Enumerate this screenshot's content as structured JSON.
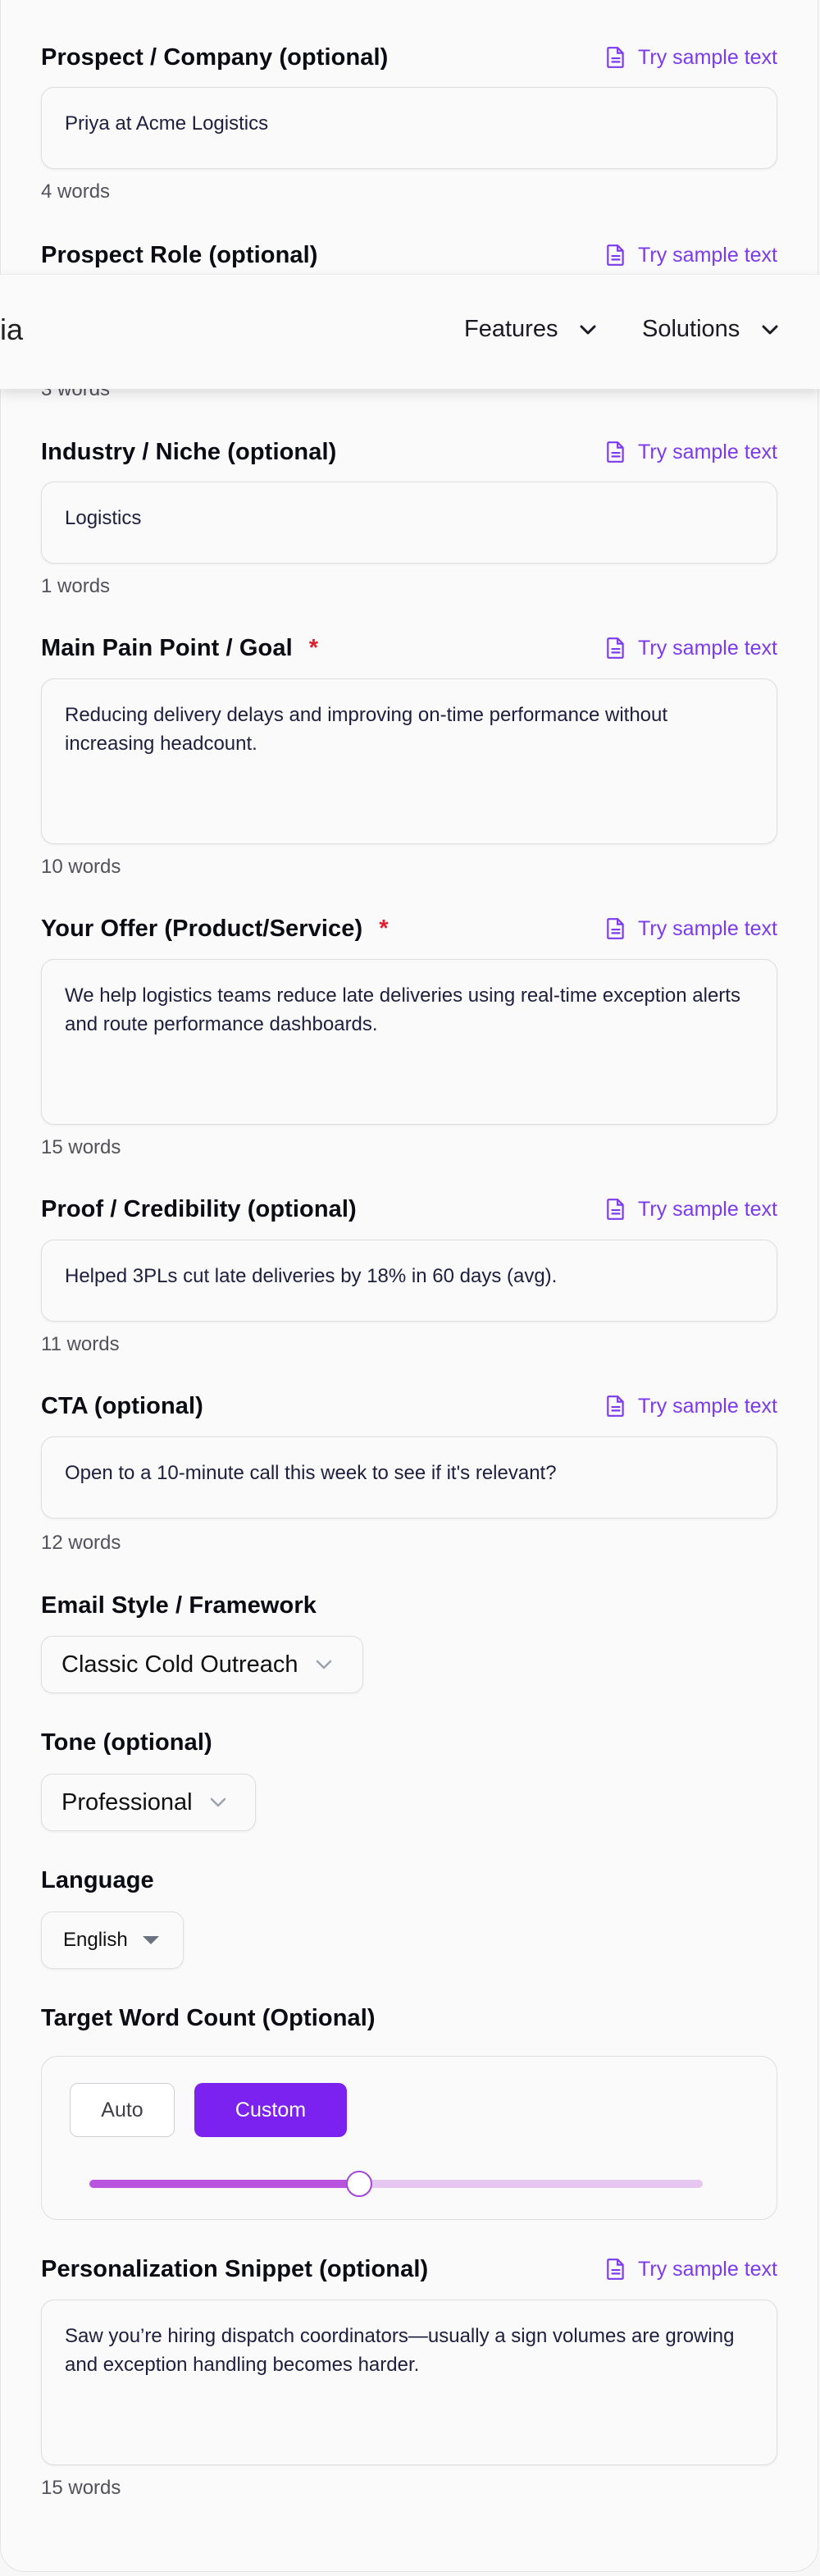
{
  "sample_link_label": "Try sample text",
  "fields": {
    "prospect": {
      "label": "Prospect / Company (optional)",
      "value": "Priya at Acme Logistics",
      "count": "4 words"
    },
    "role": {
      "label": "Prospect Role (optional)",
      "count": "3 words"
    },
    "industry": {
      "label": "Industry / Niche (optional)",
      "value": "Logistics",
      "count": "1 words"
    },
    "pain": {
      "label": "Main Pain Point / Goal",
      "required": "*",
      "value": "Reducing delivery delays and improving on-time performance without increasing headcount.",
      "count": "10 words"
    },
    "offer": {
      "label": "Your Offer (Product/Service)",
      "required": "*",
      "value": "We help logistics teams reduce late deliveries using real-time exception alerts and route performance dashboards.",
      "count": "15 words"
    },
    "proof": {
      "label": "Proof / Credibility (optional)",
      "value": "Helped 3PLs cut late deliveries by 18% in 60 days (avg).",
      "count": "11 words"
    },
    "cta": {
      "label": "CTA (optional)",
      "value": "Open to a 10-minute call this week to see if it's relevant?",
      "count": "12 words"
    },
    "snippet": {
      "label": "Personalization Snippet (optional)",
      "value": "Saw you’re hiring dispatch coordinators—usually a sign volumes are growing and exception handling becomes harder.",
      "count": "15 words"
    }
  },
  "style": {
    "label": "Email Style / Framework",
    "selected": "Classic Cold Outreach"
  },
  "tone": {
    "label": "Tone (optional)",
    "selected": "Professional"
  },
  "language": {
    "label": "Language",
    "selected": "English"
  },
  "word_count": {
    "label": "Target Word Count (Optional)",
    "auto_label": "Auto",
    "custom_label": "Custom",
    "mode": "Custom",
    "slider_fraction": 0.44
  },
  "nav": {
    "brand_fragment": "ia",
    "items": [
      "Features",
      "Solutions"
    ]
  },
  "colors": {
    "accent": "#7b22f0",
    "link": "#7c3aed",
    "required": "#e11d2e",
    "slider_fill": "#b854dd",
    "slider_track": "#e6c7f2"
  }
}
